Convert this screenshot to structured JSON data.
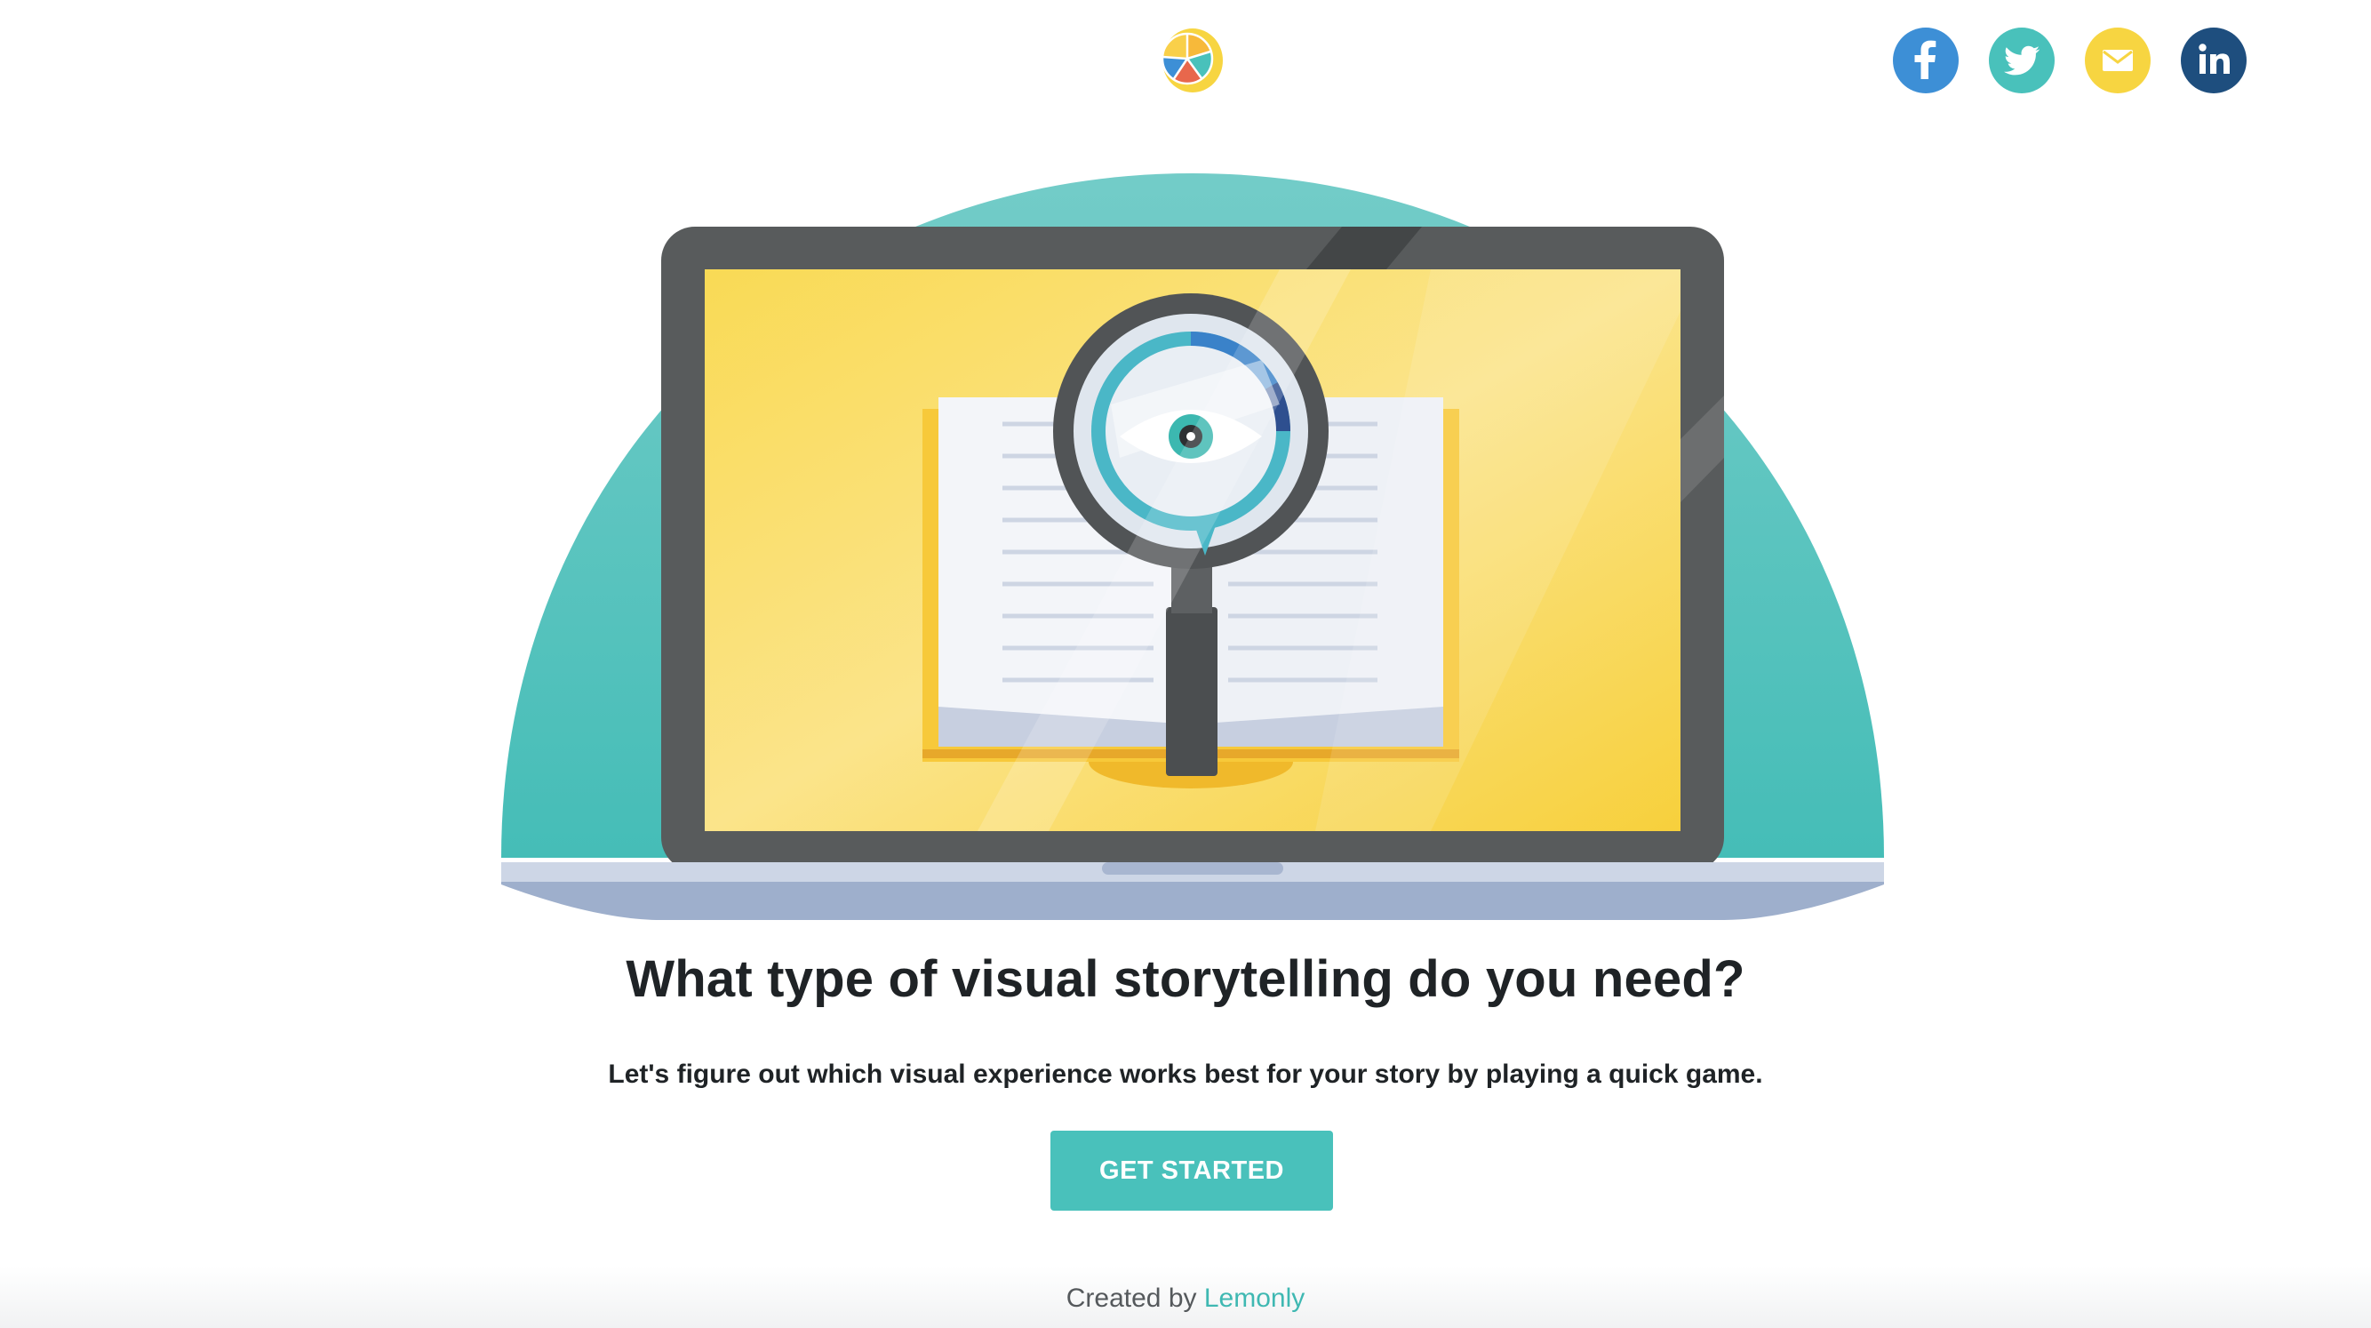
{
  "brand": {
    "logo_icon": "lemon-slice-icon",
    "colors": {
      "accent_teal": "#49c1bb",
      "lemon_yellow": "#f7d541",
      "facebook_blue": "#3d8fd6",
      "twitter_teal": "#49c1bb",
      "email_yellow": "#f7d541",
      "linkedin_navy": "#1e4e7e"
    }
  },
  "social": [
    {
      "name": "facebook",
      "icon": "facebook-icon"
    },
    {
      "name": "twitter",
      "icon": "twitter-icon"
    },
    {
      "name": "email",
      "icon": "email-icon"
    },
    {
      "name": "linkedin",
      "icon": "linkedin-icon"
    }
  ],
  "hero": {
    "illustration": "laptop-book-magnifier-eye-illustration"
  },
  "main": {
    "headline": "What type of visual storytelling do you need?",
    "subheadline": "Let's figure out which visual experience works best for your story by playing a quick game.",
    "cta_label": "GET STARTED"
  },
  "footer": {
    "created_by": "Created by",
    "company": "Lemonly"
  }
}
